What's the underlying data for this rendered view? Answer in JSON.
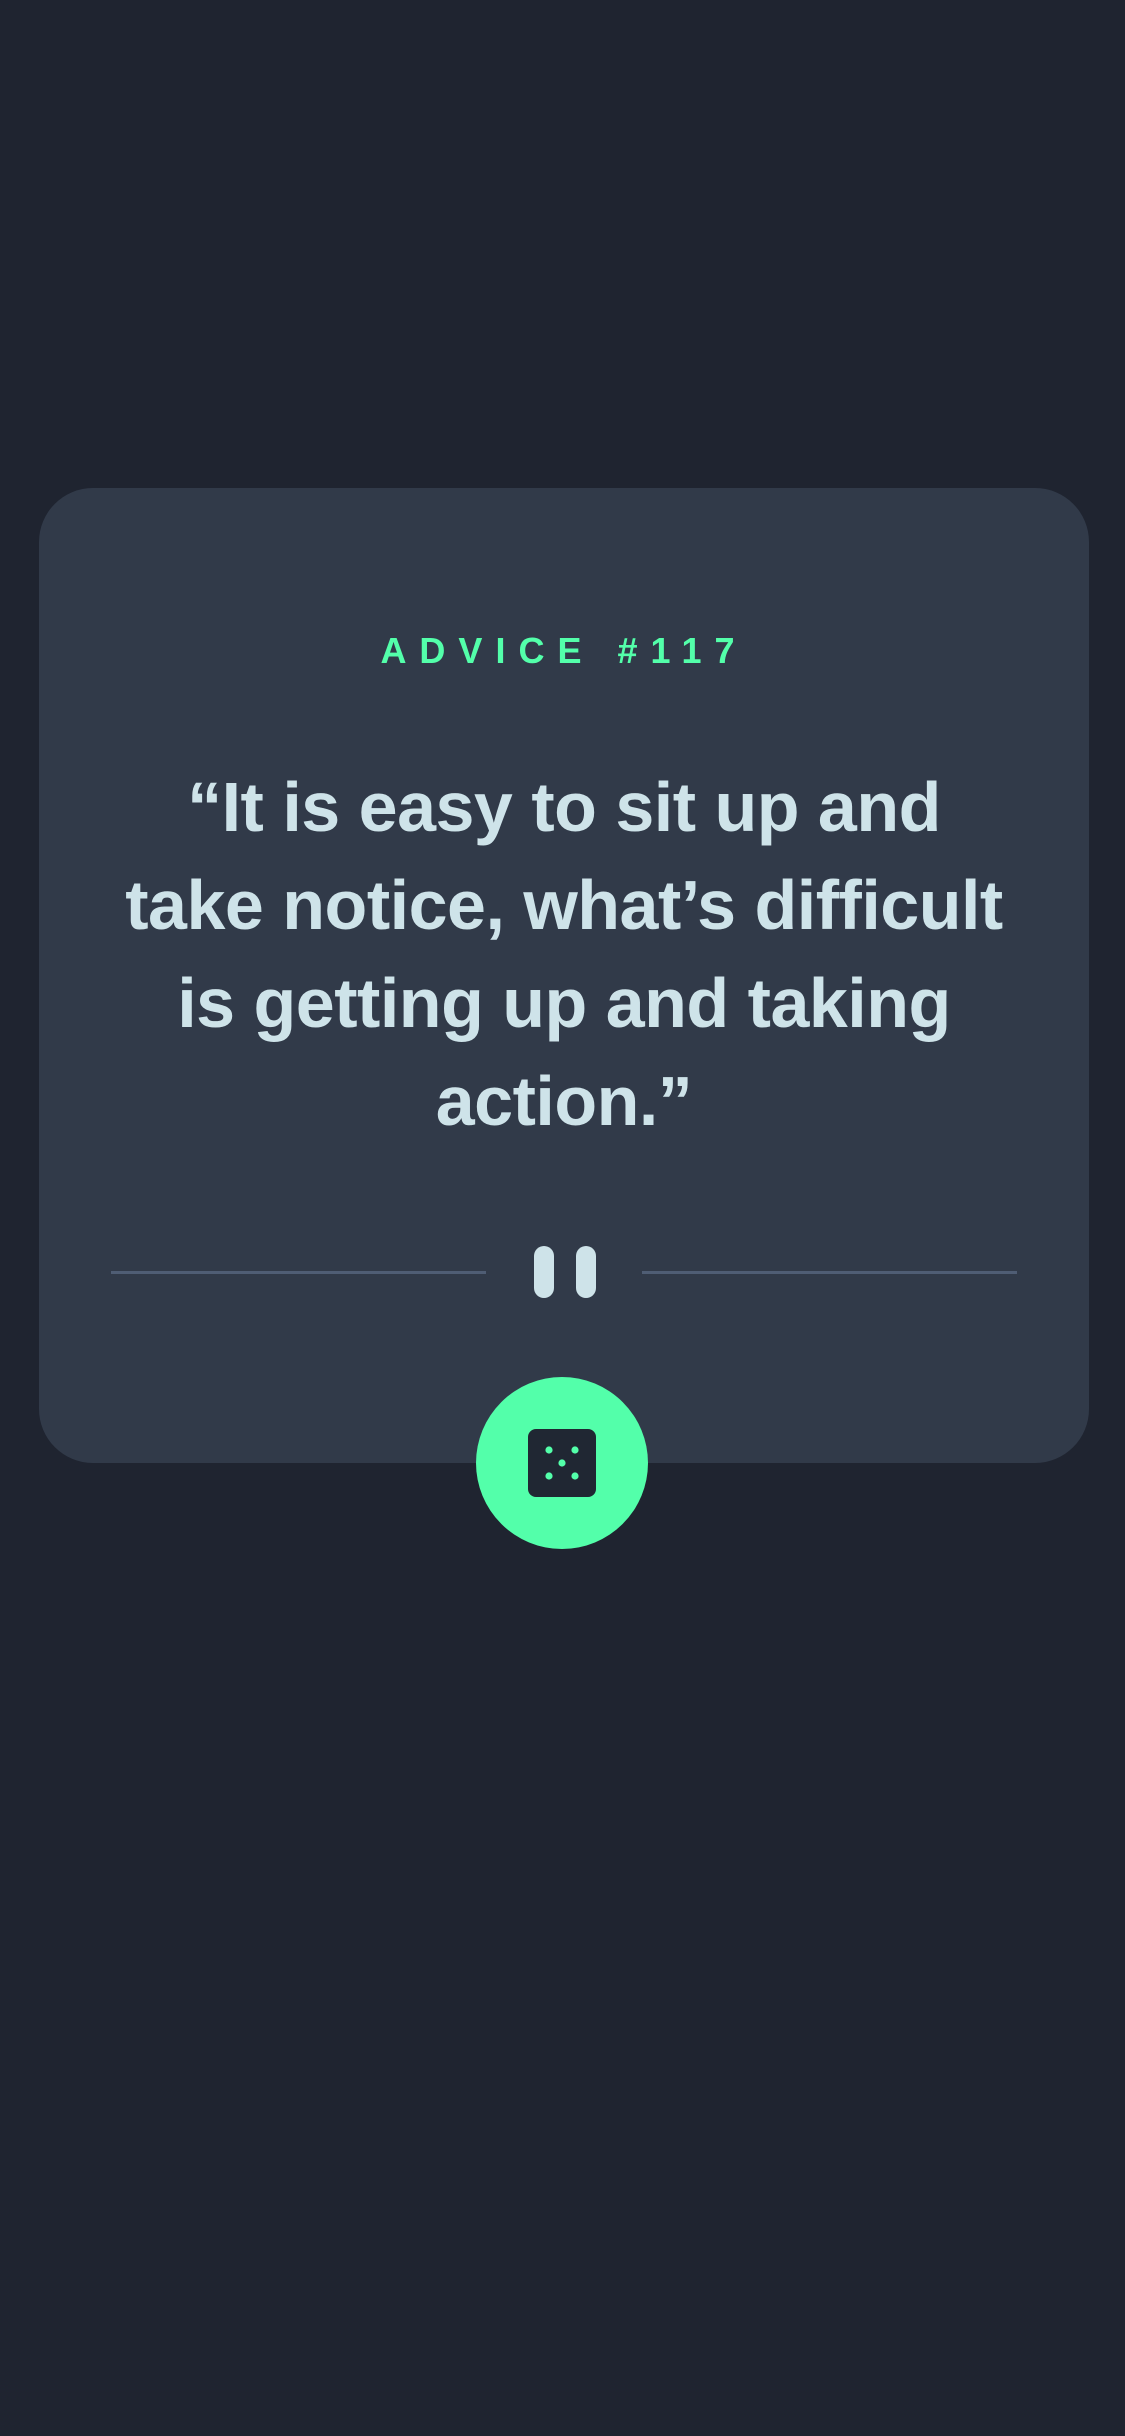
{
  "card": {
    "advice_label": "ADVICE #117",
    "quote": "“It is easy to sit up and take notice, what’s difficult is getting up and taking action.”"
  },
  "divider": {
    "icon": "pause-icon"
  },
  "dice_button": {
    "icon": "dice-icon"
  },
  "colors": {
    "background": "#1f2430",
    "card": "#313a49",
    "accent": "#53ffaa",
    "text": "#cee3e9",
    "divider": "#4f5d74"
  }
}
